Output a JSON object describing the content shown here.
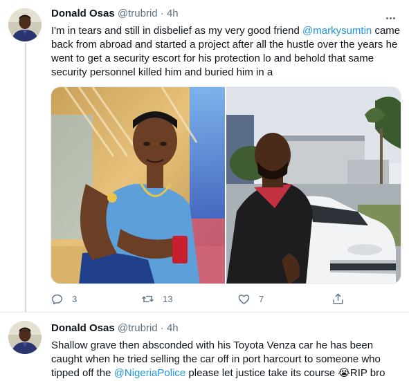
{
  "tweets": [
    {
      "display_name": "Donald Osas",
      "handle": "@trubrid",
      "dot": "·",
      "time": "4h",
      "text": {
        "part1": "I'm in tears and still in disbelief as my very good friend ",
        "mention": "@markysumtin",
        "part2": " came back from abroad and started a project after all the hustle over the years he went to get a security escort for his protection lo and behold that same security personnel killed him and buried him in a"
      },
      "actions": {
        "reply_count": "3",
        "retweet_count": "13",
        "like_count": "7"
      }
    },
    {
      "display_name": "Donald Osas",
      "handle": "@trubrid",
      "dot": "·",
      "time": "4h",
      "text": {
        "part1": "Shallow grave then absconded with his Toyota Venza car he has been caught when he tried selling the car off in port harcourt to someone who tipped off the ",
        "mention": "@NigeriaPolice",
        "part2": " please let justice take its course ",
        "emoji": "😭",
        "part3": "RIP bro"
      }
    }
  ],
  "colors": {
    "accent": "#1b95e0",
    "muted": "#5b7083",
    "divider": "#e6ecf0"
  },
  "icons": {
    "reply": "reply-icon",
    "retweet": "retweet-icon",
    "like": "like-icon",
    "share": "share-icon",
    "more": "more-icon"
  }
}
